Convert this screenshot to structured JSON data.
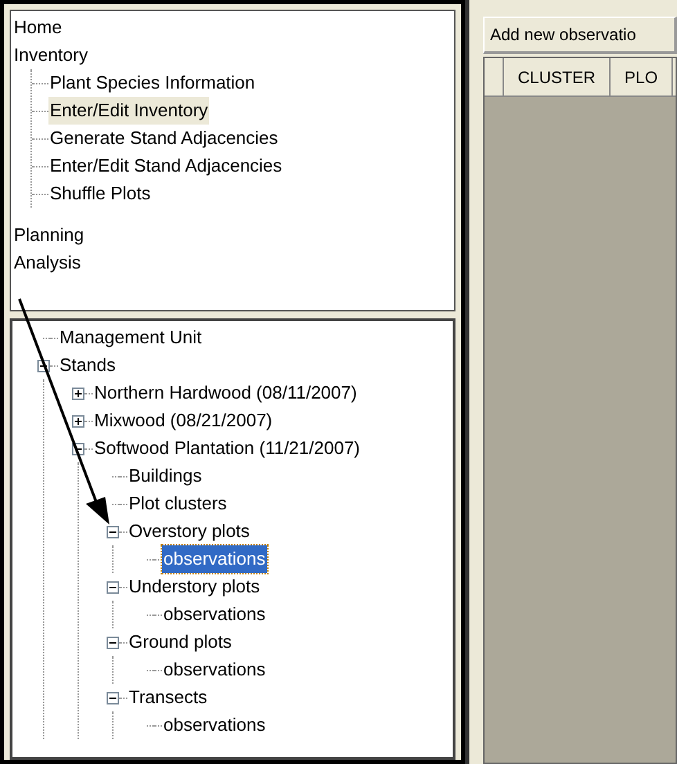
{
  "nav_menu": {
    "items": [
      {
        "label": "Home",
        "selected": false
      },
      {
        "label": "Inventory",
        "selected": false,
        "children": [
          {
            "label": "Plant Species Information",
            "selected": false
          },
          {
            "label": "Enter/Edit Inventory",
            "selected": true
          },
          {
            "label": "Generate Stand Adjacencies",
            "selected": false
          },
          {
            "label": "Enter/Edit Stand Adjacencies",
            "selected": false
          },
          {
            "label": "Shuffle Plots",
            "selected": false
          }
        ]
      },
      {
        "label": "Planning",
        "selected": false
      },
      {
        "label": "Analysis",
        "selected": false
      }
    ]
  },
  "stand_tree": {
    "items": [
      {
        "label": "Management Unit",
        "selected": false
      },
      {
        "label": "Stands",
        "selected": false,
        "expanded": true,
        "children": [
          {
            "label": "Northern Hardwood (08/11/2007)",
            "selected": false,
            "expanded": false
          },
          {
            "label": "Mixwood (08/21/2007)",
            "selected": false,
            "expanded": false
          },
          {
            "label": "Softwood Plantation (11/21/2007)",
            "selected": false,
            "expanded": true,
            "children": [
              {
                "label": "Buildings",
                "selected": false
              },
              {
                "label": "Plot clusters",
                "selected": false
              },
              {
                "label": "Overstory plots",
                "selected": false,
                "expanded": true,
                "children": [
                  {
                    "label": "observations",
                    "selected": true
                  }
                ]
              },
              {
                "label": "Understory plots",
                "selected": false,
                "expanded": true,
                "children": [
                  {
                    "label": "observations",
                    "selected": false
                  }
                ]
              },
              {
                "label": "Ground plots",
                "selected": false,
                "expanded": true,
                "children": [
                  {
                    "label": "observations",
                    "selected": false
                  }
                ]
              },
              {
                "label": "Transects",
                "selected": false,
                "expanded": true,
                "children": [
                  {
                    "label": "observations",
                    "selected": false
                  }
                ]
              }
            ]
          }
        ]
      }
    ]
  },
  "add_button": {
    "label": "Add new observatio"
  },
  "grid": {
    "columns": [
      "CLUSTER",
      "PLO"
    ]
  }
}
